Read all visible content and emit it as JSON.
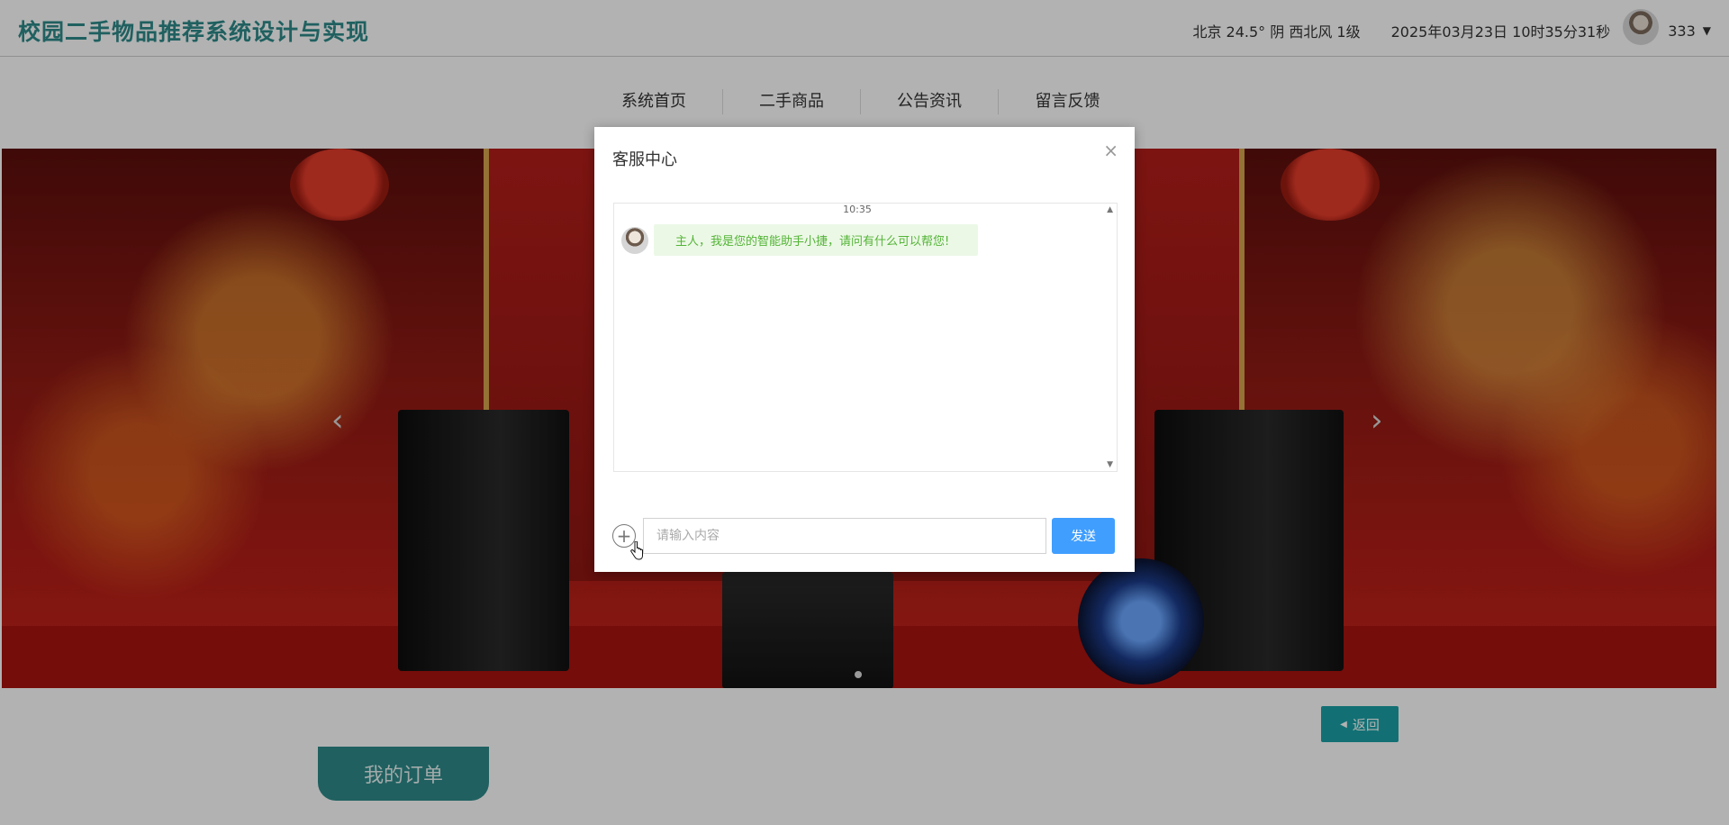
{
  "header": {
    "title": "校园二手物品推荐系统设计与实现",
    "weather": "北京  24.5°  阴  西北风  1级",
    "datetime": "2025年03月23日 10时35分31秒",
    "username": "333",
    "caret": "▼"
  },
  "nav": {
    "items": [
      {
        "label": "系统首页"
      },
      {
        "label": "二手商品"
      },
      {
        "label": "公告资讯"
      },
      {
        "label": "留言反馈"
      }
    ]
  },
  "banner": {
    "prev": "‹",
    "next": "›"
  },
  "actions": {
    "back_label": "返回",
    "back_icon": "◀",
    "orders_tab": "我的订单"
  },
  "dialog": {
    "title": "客服中心",
    "close": "×",
    "time": "10:35",
    "message": "主人，我是您的智能助手小捷，请问有什么可以帮您!",
    "input_placeholder": "请输入内容",
    "send_label": "发送",
    "plus": "+",
    "scroll_up": "▲",
    "scroll_down": "▼"
  }
}
